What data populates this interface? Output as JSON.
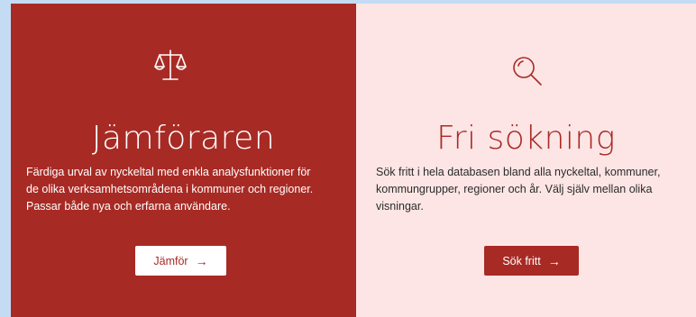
{
  "cards": {
    "jamforaren": {
      "icon": "scale-icon",
      "title": "Jämföraren",
      "description": "Färdiga urval av nyckeltal med enkla analysfunktioner för de olika verksamhetsområdena i kommuner och regioner. Passar både nya och erfarna användare.",
      "button_label": "Jämför",
      "button_arrow": "→",
      "background": "#a82a24",
      "text_color": "#ffffff"
    },
    "fri_sokning": {
      "icon": "search-icon",
      "title": "Fri sökning",
      "description": "Sök fritt i hela databasen bland alla nyckeltal, kommuner, kommungrupper, regioner och år. Välj själv mellan olika visningar.",
      "button_label": "Sök fritt",
      "button_arrow": "→",
      "background": "#fde5e5",
      "text_color": "#a82a24"
    }
  }
}
